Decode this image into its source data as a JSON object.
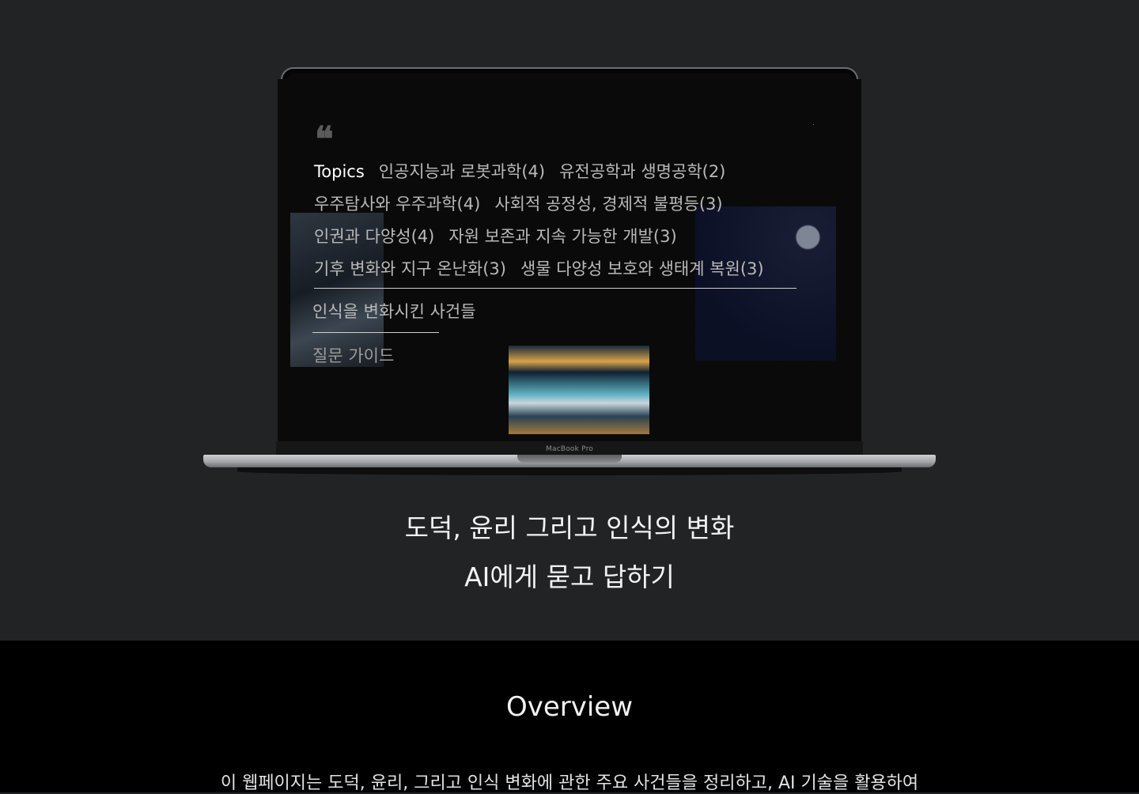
{
  "device": {
    "brand_label": "MacBook Pro"
  },
  "screen": {
    "quote_icon": "quote-icon",
    "topics_title": "Topics",
    "topics": [
      "인공지능과 로봇과학(4)",
      "유전공학과 생명공학(2)",
      "우주탐사와 우주과학(4)",
      "사회적 공정성, 경제적 불평등(3)",
      "인권과 다양성(4)",
      "자원 보존과 지속 가능한 개발(3)",
      "기후 변화와 지구 온난화(3)",
      "생물 다양성 보호와 생태계 복원(3)"
    ],
    "events_link": "인식을 변화시킨 사건들",
    "guide_link": "질문 가이드"
  },
  "hero": {
    "line1": "도덕, 윤리 그리고 인식의 변화",
    "line2": "AI에게 묻고 답하기"
  },
  "overview": {
    "title": "Overview",
    "text": "이 웹페이지는 도덕, 윤리, 그리고 인식 변화에 관한 주요 사건들을 정리하고, AI 기술을 활용하여"
  },
  "colors": {
    "hero_bg": "#222325",
    "overview_bg": "#000000",
    "screen_bg": "#0a0a0a"
  }
}
